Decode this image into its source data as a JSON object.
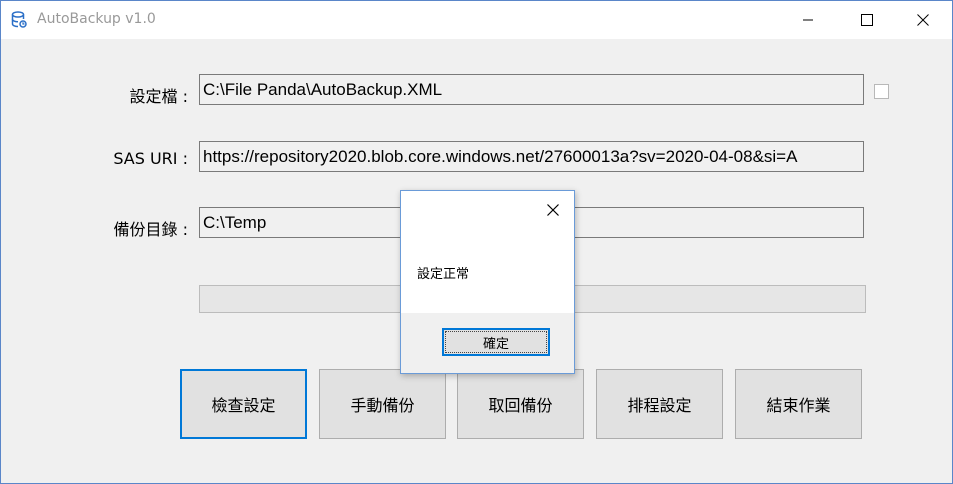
{
  "window": {
    "title": "AutoBackup v1.0",
    "icons": {
      "app": "database-icon",
      "minimize": "minimize-icon",
      "maximize": "maximize-icon",
      "close": "close-icon"
    }
  },
  "form": {
    "config_label": "設定檔 :",
    "config_value": "C:\\File Panda\\AutoBackup.XML",
    "sas_label": "SAS URI :",
    "sas_value": "https://repository2020.blob.core.windows.net/27600013a?sv=2020-04-08&si=A",
    "dir_label": "備份目錄 :",
    "dir_value": "C:\\Temp",
    "checkbox_checked": false,
    "progress": 0
  },
  "buttons": {
    "check": "檢查設定",
    "manual": "手動備份",
    "restore": "取回備份",
    "schedule": "排程設定",
    "exit": "結束作業"
  },
  "dialog": {
    "message": "設定正常",
    "ok_label": "確定"
  },
  "colors": {
    "accent": "#0078d7",
    "window_border": "#5a86c9"
  }
}
